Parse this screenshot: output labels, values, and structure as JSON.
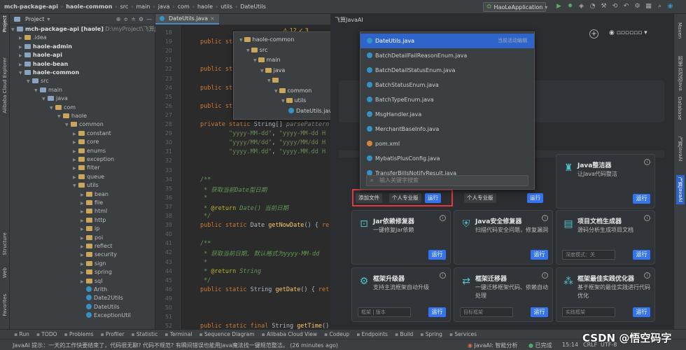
{
  "topbar": {
    "crumbs": [
      "mch-package-api",
      "haole-common",
      "src",
      "main",
      "java",
      "com",
      "haole",
      "utils",
      "DateUtils"
    ],
    "run_config": "HaoLeApplication"
  },
  "left_strip": {
    "project": "Project",
    "alibaba": "Alibaba Cloud Explorer",
    "structure": "Structure",
    "web": "Web",
    "favorites": "Favorites"
  },
  "right_strip": {
    "maven": "Maven",
    "aliyun": "阿里云对话Java",
    "database": "Database",
    "ai_dialog": "飞算JavaAI",
    "javaai": "飞算JavaAI"
  },
  "project": {
    "title": "Project",
    "root": "mch-package-api [haole]",
    "root_path": "D:\\myProject\\飞算JavaAI",
    "items": [
      {
        "name": ".idea",
        "indent": 1,
        "arrow": "▶",
        "type": "folder"
      },
      {
        "name": "haole-admin",
        "indent": 1,
        "arrow": "▶",
        "type": "module"
      },
      {
        "name": "haole-api",
        "indent": 1,
        "arrow": "▶",
        "type": "module"
      },
      {
        "name": "haole-bean",
        "indent": 1,
        "arrow": "▶",
        "type": "module"
      },
      {
        "name": "haole-common",
        "indent": 1,
        "arrow": "▼",
        "type": "module"
      },
      {
        "name": "src",
        "indent": 2,
        "arrow": "▼",
        "type": "folder"
      },
      {
        "name": "main",
        "indent": 3,
        "arrow": "▼",
        "type": "folder"
      },
      {
        "name": "java",
        "indent": 4,
        "arrow": "▼",
        "type": "folder"
      },
      {
        "name": "com",
        "indent": 5,
        "arrow": "▼",
        "type": "folder"
      },
      {
        "name": "haole",
        "indent": 6,
        "arrow": "▼",
        "type": "folder"
      },
      {
        "name": "common",
        "indent": 7,
        "arrow": "▼",
        "type": "folder"
      },
      {
        "name": "constant",
        "indent": 8,
        "arrow": "▶",
        "type": "folder"
      },
      {
        "name": "core",
        "indent": 8,
        "arrow": "▶",
        "type": "folder"
      },
      {
        "name": "enums",
        "indent": 8,
        "arrow": "▶",
        "type": "folder"
      },
      {
        "name": "exception",
        "indent": 8,
        "arrow": "▶",
        "type": "folder"
      },
      {
        "name": "filter",
        "indent": 8,
        "arrow": "▶",
        "type": "folder"
      },
      {
        "name": "queue",
        "indent": 8,
        "arrow": "▶",
        "type": "folder"
      },
      {
        "name": "utils",
        "indent": 8,
        "arrow": "▼",
        "type": "folder"
      },
      {
        "name": "bean",
        "indent": 9,
        "arrow": "▶",
        "type": "folder"
      },
      {
        "name": "file",
        "indent": 9,
        "arrow": "▶",
        "type": "folder"
      },
      {
        "name": "html",
        "indent": 9,
        "arrow": "▶",
        "type": "folder"
      },
      {
        "name": "http",
        "indent": 9,
        "arrow": "▶",
        "type": "folder"
      },
      {
        "name": "ip",
        "indent": 9,
        "arrow": "▶",
        "type": "folder"
      },
      {
        "name": "poi",
        "indent": 9,
        "arrow": "▶",
        "type": "folder"
      },
      {
        "name": "reflect",
        "indent": 9,
        "arrow": "▶",
        "type": "folder"
      },
      {
        "name": "security",
        "indent": 9,
        "arrow": "▶",
        "type": "folder"
      },
      {
        "name": "sign",
        "indent": 9,
        "arrow": "▶",
        "type": "folder"
      },
      {
        "name": "spring",
        "indent": 9,
        "arrow": "▶",
        "type": "folder"
      },
      {
        "name": "sql",
        "indent": 9,
        "arrow": "▶",
        "type": "folder"
      },
      {
        "name": "Arith",
        "indent": 9,
        "arrow": "",
        "type": "class"
      },
      {
        "name": "Date2Utils",
        "indent": 9,
        "arrow": "",
        "type": "class"
      },
      {
        "name": "DateUtils",
        "indent": 9,
        "arrow": "",
        "type": "class"
      },
      {
        "name": "ExceptionUtil",
        "indent": 9,
        "arrow": "",
        "type": "class"
      }
    ]
  },
  "editor": {
    "tab": "DateUtils.java",
    "warnings": "⚠ 12  ✓ 3",
    "lines": [
      {
        "n": "18",
        "html": ""
      },
      {
        "n": "19",
        "html": "<span class='kw'>public static</span>"
      },
      {
        "n": "20",
        "html": ""
      },
      {
        "n": "21",
        "html": ""
      },
      {
        "n": "22",
        "html": "<span class='kw'>public st</span>"
      },
      {
        "n": "23",
        "html": ""
      },
      {
        "n": "24",
        "html": "<span class='kw'>public st</span>"
      },
      {
        "n": "25",
        "html": ""
      },
      {
        "n": "26",
        "html": "<span class='kw'>public st</span>"
      },
      {
        "n": "27",
        "html": ""
      },
      {
        "n": "28",
        "html": "<span class='kw'>private static</span> String[] <span class='pm'>parsePattern</span>"
      },
      {
        "n": "29",
        "html": "        <span class='str'>\"yyyy-MM-dd\"</span>, <span class='str'>\"yyyy-MM-dd H</span>"
      },
      {
        "n": "30",
        "html": "        <span class='str'>\"yyyy/MM/dd\"</span>, <span class='str'>\"yyyy/MM/dd H</span>"
      },
      {
        "n": "31",
        "html": "        <span class='str'>\"yyyy.MM.dd\"</span>, <span class='str'>\"yyyy.MM.dd H</span>"
      },
      {
        "n": "32",
        "html": ""
      },
      {
        "n": "33",
        "html": ""
      },
      {
        "n": "34",
        "html": "<span class='cm'>/**</span>"
      },
      {
        "n": "35",
        "html": "<span class='cm'> * 获取当前Date型日期</span>"
      },
      {
        "n": "36",
        "html": "<span class='cm'> *</span>"
      },
      {
        "n": "37",
        "html": "<span class='cm'> * </span><span class='ann'>@return</span><span class='cm'> Date() 当前日期</span>"
      },
      {
        "n": "38",
        "html": "<span class='cm'> */</span>"
      },
      {
        "n": "39",
        "html": "<span class='kw'>public static</span> Date <span class='fn'>getNowDate</span>() { <span class='kw'>re</span>"
      },
      {
        "n": "40",
        "html": ""
      },
      {
        "n": "41",
        "html": "<span class='cm'>/**</span>"
      },
      {
        "n": "42",
        "html": "<span class='cm'> * 获取当前日期, 默认格式为yyyy-MM-dd</span>"
      },
      {
        "n": "43",
        "html": "<span class='cm'> *</span>"
      },
      {
        "n": "44",
        "html": "<span class='cm'> * </span><span class='ann'>@return</span><span class='cm'> String</span>"
      },
      {
        "n": "45",
        "html": "<span class='cm'> */</span>"
      },
      {
        "n": "46",
        "html": "<span class='kw'>public static</span> String <span class='fn'>getDate</span>() { <span class='kw'>ret</span>"
      },
      {
        "n": "49",
        "html": ""
      },
      {
        "n": "50",
        "html": ""
      },
      {
        "n": "51",
        "html": ""
      },
      {
        "n": "52",
        "html": "<span class='kw'>public static final</span> String <span class='fn'>getTime</span>()"
      }
    ]
  },
  "tree_popup": {
    "items": [
      {
        "name": "haole-common",
        "indent": 0
      },
      {
        "name": "src",
        "indent": 1
      },
      {
        "name": "main",
        "indent": 2
      },
      {
        "name": "java",
        "indent": 3
      },
      {
        "name": "",
        "indent": 4
      },
      {
        "name": "common",
        "indent": 5
      },
      {
        "name": "utils",
        "indent": 6
      },
      {
        "name": "DateUtils.java",
        "indent": 7
      }
    ]
  },
  "ai_panel": {
    "title": "飞算JavaAI",
    "cards": [
      {
        "title": "Java整洁器",
        "desc": "让Java代码整洁",
        "icon": "♜",
        "run": "运行",
        "input": ""
      },
      {
        "title": "Jar依赖修复器",
        "desc": "一键修复Jar依赖",
        "icon": "⊡",
        "run": "运行",
        "input": ""
      },
      {
        "title": "Java安全修复器",
        "desc": "扫描代码安全问题，修复漏洞",
        "icon": "⛨",
        "run": "运行",
        "input": ""
      },
      {
        "title": "项目文档生成器",
        "desc": "源码分析生成项目文档",
        "icon": "▤",
        "run": "运行",
        "input": "深度模式：关"
      },
      {
        "title": "框架升级器",
        "desc": "支持主流框架自动升级",
        "icon": "⚙",
        "run": "运行",
        "input": "框架 | 版本"
      },
      {
        "title": "框架迁移器",
        "desc": "一键迁移框架代码、依赖自动处理",
        "icon": "⇄",
        "run": "运行",
        "input": "目标框架"
      },
      {
        "title": "框架最佳实践优化器",
        "desc": "基于框架的最佳实践进行代码优化",
        "icon": "⁂",
        "run": "运行",
        "input": "实践框架"
      }
    ],
    "add_file": "添加文件",
    "pro_version": "个人专业版",
    "pro_version2": "个人专业版",
    "run": "运行",
    "run2": "运行"
  },
  "file_list": {
    "hint": "当前活动编辑",
    "items": [
      "DateUtils.java",
      "BatchDetailFailReasonEnum.java",
      "BatchDetailStatusEnum.java",
      "BatchStatusEnum.java",
      "BatchTypeEnum.java",
      "MsgHandler.java",
      "MerchantBaseInfo.java",
      "pom.xml",
      "MybatisPlusConfig.java",
      "TransferBillsNotifyResult.java"
    ],
    "search_placeholder": "输入关键字搜索"
  },
  "bottom_tabs": [
    "Run",
    "TODO",
    "Problems",
    "Profiler",
    "Statistic",
    "Terminal",
    "Sequence Diagram",
    "Alibaba Cloud View",
    "Codeup",
    "Endpoints",
    "Build",
    "Spring",
    "Services"
  ],
  "status": {
    "message": "JavaAI 提示：一天的工作快要结束了，代码很无聊? 代码不规范? 有瞬间错误也能用Java魔法找一键规范整洁。 (26 minutes ago)",
    "javaai": "JavaAI: 智能分析",
    "state": "已完成",
    "pos": "15:14",
    "lf": "CRLF",
    "enc": "UTF-8",
    "watermark": "CSDN @悟空码字"
  }
}
